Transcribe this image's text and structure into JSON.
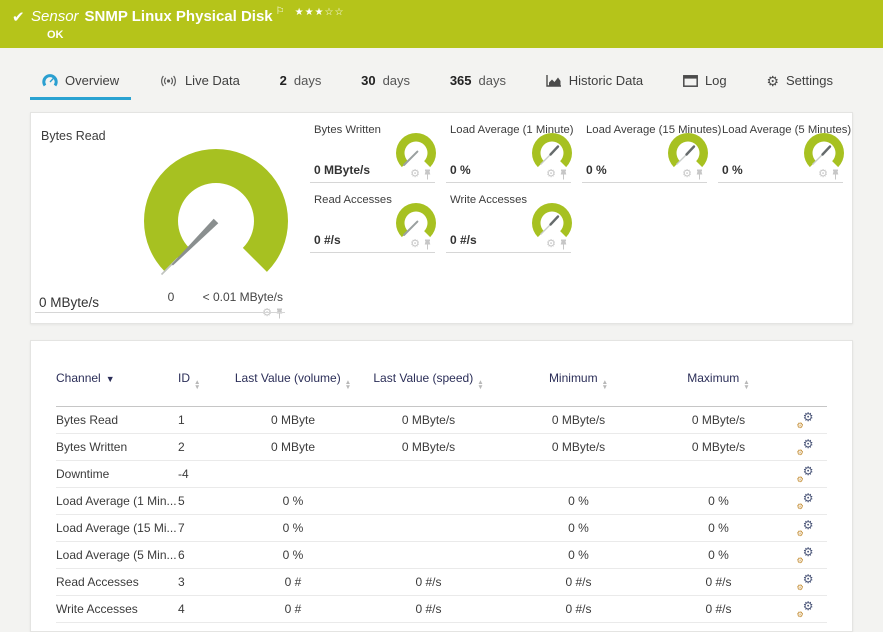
{
  "sensor_header": {
    "type_label": "Sensor",
    "name": "SNMP Linux Physical Disk",
    "status": "OK",
    "stars": "★★★☆☆",
    "color": "#b5c41a"
  },
  "tabs": [
    {
      "label": "Overview",
      "active": true
    },
    {
      "label": "Live Data"
    },
    {
      "num": "2",
      "label": "days"
    },
    {
      "num": "30",
      "label": "days"
    },
    {
      "num": "365",
      "label": "days"
    },
    {
      "label": "Historic Data"
    },
    {
      "label": "Log"
    },
    {
      "label": "Settings"
    }
  ],
  "gauges": {
    "main": {
      "label": "Bytes Read",
      "value": "0 MByte/s",
      "scale_min": "0",
      "scale_max": "< 0.01 MByte/s",
      "color": "#a7c121"
    },
    "small": [
      {
        "label": "Bytes Written",
        "value": "0 MByte/s",
        "needle": "sw"
      },
      {
        "label": "Load Average (1 Minute)",
        "value": "0 %",
        "needle": "ne"
      },
      {
        "label": "Load Average (15 Minutes)",
        "value": "0 %",
        "needle": "ne"
      },
      {
        "label": "Load Average (5 Minutes)",
        "value": "0 %",
        "needle": "ne"
      },
      {
        "label": "Read Accesses",
        "value": "0 #/s",
        "needle": "sw"
      },
      {
        "label": "Write Accesses",
        "value": "0 #/s",
        "needle": "ne"
      }
    ]
  },
  "channel_table": {
    "columns": [
      {
        "label": "Channel",
        "sorted": true
      },
      {
        "label": "ID",
        "sorted": false
      },
      {
        "label": "Last Value (volume)",
        "sorted": false
      },
      {
        "label": "Last Value (speed)",
        "sorted": false
      },
      {
        "label": "Minimum",
        "sorted": false
      },
      {
        "label": "Maximum",
        "sorted": false
      }
    ],
    "rows": [
      {
        "channel": "Bytes Read",
        "id": "1",
        "volume": "0 MByte",
        "speed": "0 MByte/s",
        "min": "0 MByte/s",
        "max": "0 MByte/s"
      },
      {
        "channel": "Bytes Written",
        "id": "2",
        "volume": "0 MByte",
        "speed": "0 MByte/s",
        "min": "0 MByte/s",
        "max": "0 MByte/s"
      },
      {
        "channel": "Downtime",
        "id": "-4",
        "volume": "",
        "speed": "",
        "min": "",
        "max": ""
      },
      {
        "channel": "Load Average (1 Min...",
        "id": "5",
        "volume": "0 %",
        "speed": "",
        "min": "0 %",
        "max": "0 %"
      },
      {
        "channel": "Load Average (15 Mi...",
        "id": "7",
        "volume": "0 %",
        "speed": "",
        "min": "0 %",
        "max": "0 %"
      },
      {
        "channel": "Load Average (5 Min...",
        "id": "6",
        "volume": "0 %",
        "speed": "",
        "min": "0 %",
        "max": "0 %"
      },
      {
        "channel": "Read Accesses",
        "id": "3",
        "volume": "0 #",
        "speed": "0 #/s",
        "min": "0 #/s",
        "max": "0 #/s"
      },
      {
        "channel": "Write Accesses",
        "id": "4",
        "volume": "0 #",
        "speed": "0 #/s",
        "min": "0 #/s",
        "max": "0 #/s"
      }
    ]
  }
}
